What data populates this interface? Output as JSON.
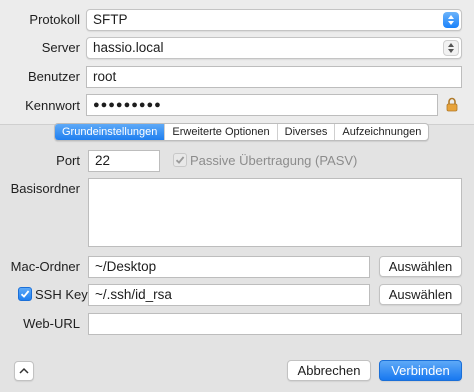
{
  "form": {
    "protokoll_label": "Protokoll",
    "protokoll_value": "SFTP",
    "server_label": "Server",
    "server_value": "hassio.local",
    "benutzer_label": "Benutzer",
    "benutzer_value": "root",
    "kennwort_label": "Kennwort",
    "kennwort_value": "●●●●●●●●●",
    "lock_icon": "lock-icon"
  },
  "tabs": [
    {
      "label": "Grundeinstellungen",
      "active": true
    },
    {
      "label": "Erweiterte Optionen",
      "active": false
    },
    {
      "label": "Diverses",
      "active": false
    },
    {
      "label": "Aufzeichnungen",
      "active": false
    }
  ],
  "settings": {
    "port_label": "Port",
    "port_value": "22",
    "pasv_label": "Passive Übertragung (PASV)",
    "pasv_checked": true,
    "pasv_enabled": false,
    "basisordner_label": "Basisordner",
    "basisordner_value": "",
    "mac_ordner_label": "Mac-Ordner",
    "mac_ordner_value": "~/Desktop",
    "mac_ordner_button": "Auswählen",
    "ssh_key_label": "SSH Key",
    "ssh_key_checked": true,
    "ssh_key_value": "~/.ssh/id_rsa",
    "ssh_key_button": "Auswählen",
    "web_url_label": "Web-URL",
    "web_url_value": ""
  },
  "footer": {
    "collapse_icon": "chevron-up-icon",
    "cancel_label": "Abbrechen",
    "connect_label": "Verbinden"
  },
  "colors": {
    "accent": "#1f7ff0",
    "background": "#ececec"
  }
}
